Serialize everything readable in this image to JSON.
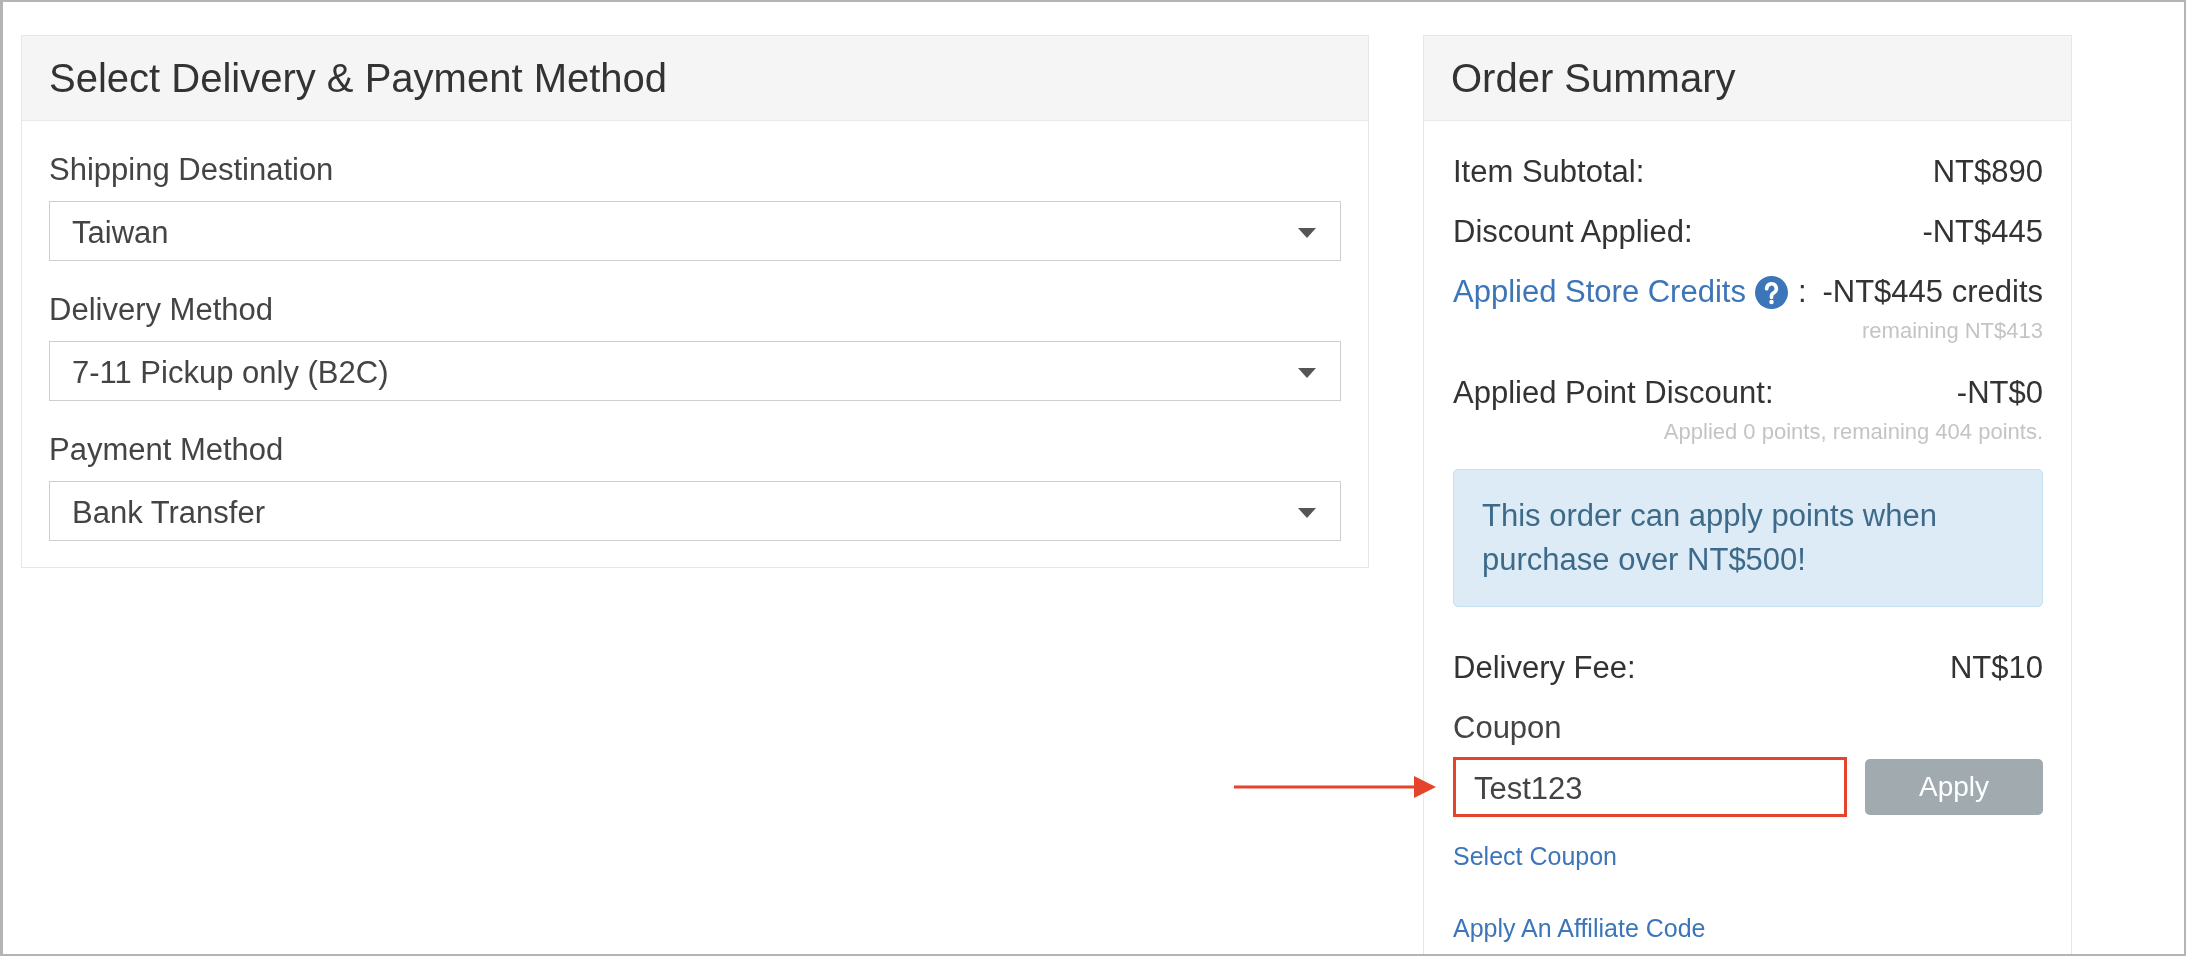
{
  "delivery_payment": {
    "title": "Select Delivery & Payment Method",
    "fields": [
      {
        "label": "Shipping Destination",
        "value": "Taiwan"
      },
      {
        "label": "Delivery Method",
        "value": "7-11 Pickup only (B2C)"
      },
      {
        "label": "Payment Method",
        "value": "Bank Transfer"
      }
    ]
  },
  "order_summary": {
    "title": "Order Summary",
    "items": [
      {
        "kind": "amount",
        "label": "Item Subtotal:",
        "value": "NT$890"
      },
      {
        "kind": "amount",
        "label": "Discount Applied:",
        "value": "-NT$445"
      },
      {
        "kind": "credit",
        "label": "Applied Store Credits",
        "separator": ":",
        "value": "-NT$445 credits",
        "note": "remaining NT$413"
      },
      {
        "kind": "amount",
        "label": "Applied Point Discount:",
        "value": "-NT$0",
        "note": "Applied 0 points, remaining 404 points."
      },
      {
        "kind": "notice",
        "text": "This order can apply points when purchase over NT$500!"
      },
      {
        "kind": "amount",
        "label": "Delivery Fee:",
        "value": "NT$10"
      }
    ],
    "coupon": {
      "label": "Coupon",
      "value": "Test123",
      "highlighted": true,
      "button": {
        "label": "Apply",
        "disabled": true
      }
    },
    "links": [
      "Select Coupon",
      "Apply An Affiliate Code"
    ]
  }
}
